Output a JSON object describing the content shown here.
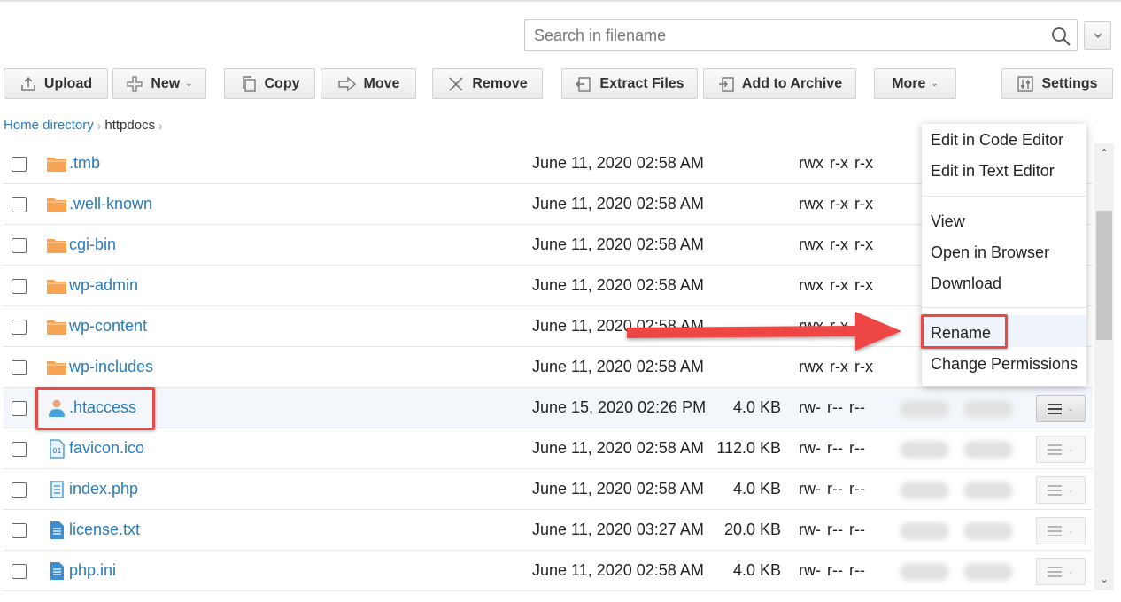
{
  "search": {
    "placeholder": "Search in filename"
  },
  "toolbar": {
    "upload": "Upload",
    "new": "New",
    "copy": "Copy",
    "move": "Move",
    "remove": "Remove",
    "extract": "Extract Files",
    "archive": "Add to Archive",
    "more": "More",
    "settings": "Settings"
  },
  "breadcrumb": {
    "home": "Home directory",
    "current": "httpdocs"
  },
  "files": [
    {
      "name": ".tmb",
      "type": "folder",
      "date": "June 11, 2020 02:58 AM",
      "size": "",
      "perms": "rwx r-x r-x"
    },
    {
      "name": ".well-known",
      "type": "folder",
      "date": "June 11, 2020 02:58 AM",
      "size": "",
      "perms": "rwx r-x r-x"
    },
    {
      "name": "cgi-bin",
      "type": "folder",
      "date": "June 11, 2020 02:58 AM",
      "size": "",
      "perms": "rwx r-x r-x"
    },
    {
      "name": "wp-admin",
      "type": "folder",
      "date": "June 11, 2020 02:58 AM",
      "size": "",
      "perms": "rwx r-x r-x"
    },
    {
      "name": "wp-content",
      "type": "folder",
      "date": "June 11, 2020 02:58 AM",
      "size": "",
      "perms": "rwx r-x r-x"
    },
    {
      "name": "wp-includes",
      "type": "folder",
      "date": "June 11, 2020 02:58 AM",
      "size": "",
      "perms": "rwx r-x r-x"
    },
    {
      "name": ".htaccess",
      "type": "htaccess",
      "date": "June 15, 2020 02:26 PM",
      "size": "4.0 KB",
      "perms": "rw- r-- r--"
    },
    {
      "name": "favicon.ico",
      "type": "binary",
      "date": "June 11, 2020 02:58 AM",
      "size": "112.0 KB",
      "perms": "rw- r-- r--"
    },
    {
      "name": "index.php",
      "type": "script",
      "date": "June 11, 2020 02:58 AM",
      "size": "4.0 KB",
      "perms": "rw- r-- r--"
    },
    {
      "name": "license.txt",
      "type": "text",
      "date": "June 11, 2020 03:27 AM",
      "size": "20.0 KB",
      "perms": "rw- r-- r--"
    },
    {
      "name": "php.ini",
      "type": "text",
      "date": "June 11, 2020 02:58 AM",
      "size": "4.0 KB",
      "perms": "rw- r-- r--"
    }
  ],
  "context_menu": {
    "edit_code": "Edit in Code Editor",
    "edit_text": "Edit in Text Editor",
    "view": "View",
    "open_browser": "Open in Browser",
    "download": "Download",
    "rename": "Rename",
    "change_perms": "Change Permissions"
  },
  "colors": {
    "link": "#2a7ab8",
    "folder": "#f5a454",
    "highlight": "#e84a4a"
  }
}
